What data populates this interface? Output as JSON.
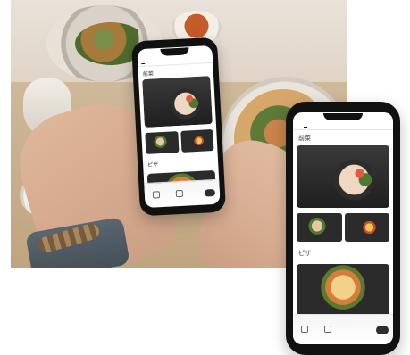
{
  "colors": {
    "phone_frame": "#111111",
    "screen_bg": "#ffffff",
    "accent_dark": "#2d2d2d"
  },
  "phones": {
    "small": {
      "tabs": [
        "",
        "",
        "",
        "",
        ""
      ],
      "section_title": "前菜",
      "hero_caption": "",
      "tiles": [
        {
          "label": ""
        },
        {
          "label": ""
        }
      ],
      "section_title_2": "ピザ",
      "bottom_nav": [
        {
          "label": "",
          "icon": "menu-icon"
        },
        {
          "label": "",
          "icon": "user-icon"
        }
      ],
      "order_button": ""
    },
    "big": {
      "tabs": [
        "",
        "",
        "",
        "",
        ""
      ],
      "section_title": "前菜",
      "hero_caption": "",
      "tiles": [
        {
          "label": ""
        },
        {
          "label": ""
        }
      ],
      "section_title_2": "ピザ",
      "bottom_nav": [
        {
          "label": "",
          "icon": "menu-icon"
        },
        {
          "label": "",
          "icon": "user-icon"
        }
      ],
      "order_button": ""
    }
  }
}
